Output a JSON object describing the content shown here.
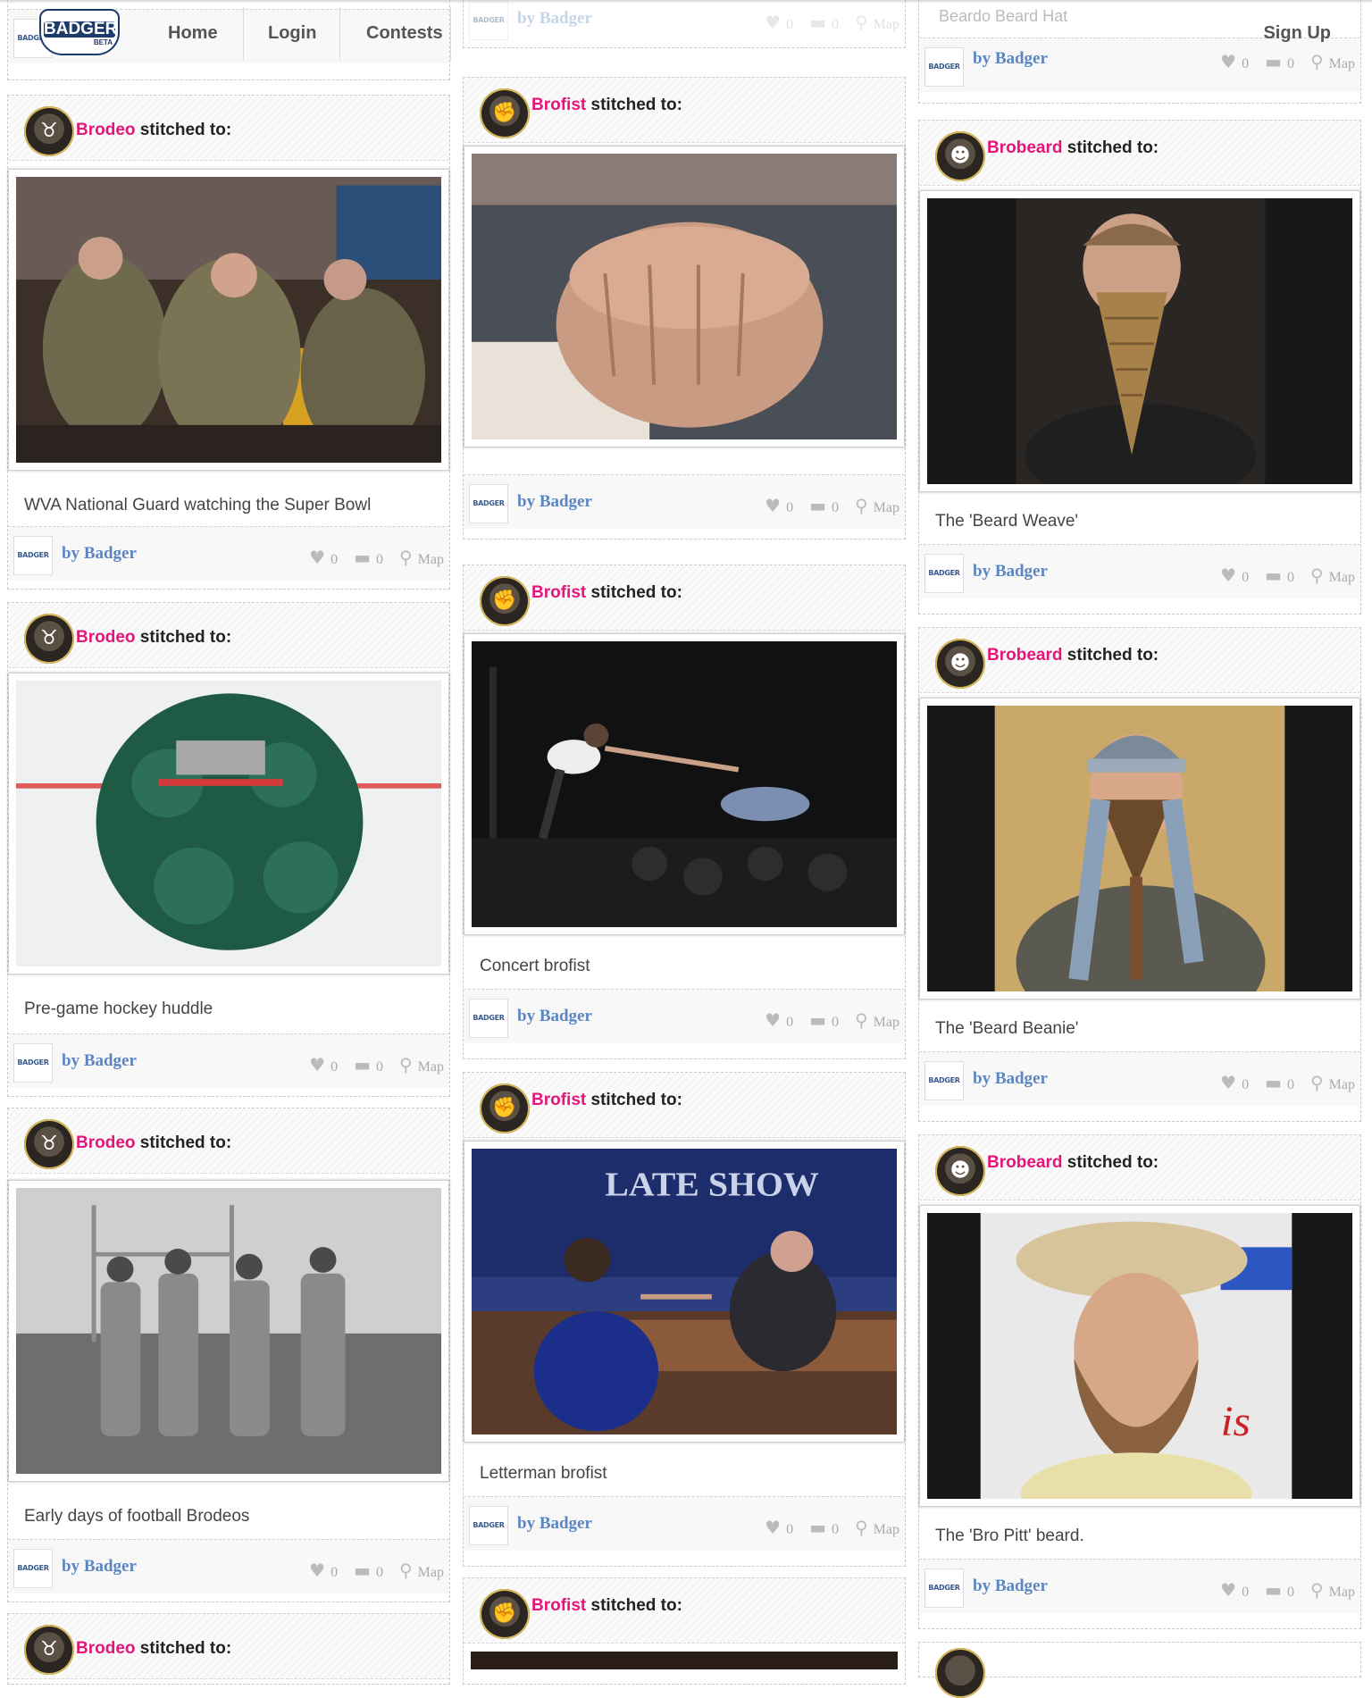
{
  "nav": {
    "logo": "BADGER",
    "logo_beta": "BETA",
    "home": "Home",
    "login": "Login",
    "contests": "Contests",
    "signup": "Sign Up"
  },
  "partial": {
    "col3_title": "Beardo Beard Hat",
    "mini_logo": "BADGER",
    "by": "by Badger",
    "likes": "0",
    "comments": "0",
    "map": "Map"
  },
  "columns": [
    {
      "cards": [
        {
          "user": "Brodeo",
          "stitched": "stitched to:",
          "caption": "WVA National Guard watching the Super Bowl",
          "by": "by Badger",
          "likes": "0",
          "comments": "0",
          "map": "Map"
        },
        {
          "user": "Brodeo",
          "stitched": "stitched to:",
          "caption": "Pre-game hockey huddle",
          "by": "by Badger",
          "likes": "0",
          "comments": "0",
          "map": "Map"
        },
        {
          "user": "Brodeo",
          "stitched": "stitched to:",
          "caption": "Early days of football Brodeos",
          "by": "by Badger",
          "likes": "0",
          "comments": "0",
          "map": "Map"
        },
        {
          "user": "Brodeo",
          "stitched": "stitched to:"
        }
      ]
    },
    {
      "cards": [
        {
          "user": "Brofist",
          "stitched": "stitched to:",
          "caption": "",
          "by": "by Badger",
          "likes": "0",
          "comments": "0",
          "map": "Map"
        },
        {
          "user": "Brofist",
          "stitched": "stitched to:",
          "caption": "Concert brofist",
          "by": "by Badger",
          "likes": "0",
          "comments": "0",
          "map": "Map"
        },
        {
          "user": "Brofist",
          "stitched": "stitched to:",
          "caption": "Letterman brofist",
          "by": "by Badger",
          "likes": "0",
          "comments": "0",
          "map": "Map"
        },
        {
          "user": "Brofist",
          "stitched": "stitched to:"
        }
      ]
    },
    {
      "cards": [
        {
          "user": "Brobeard",
          "stitched": "stitched to:",
          "caption": "The 'Beard Weave'",
          "by": "by Badger",
          "likes": "0",
          "comments": "0",
          "map": "Map"
        },
        {
          "user": "Brobeard",
          "stitched": "stitched to:",
          "caption": "The 'Beard Beanie'",
          "by": "by Badger",
          "likes": "0",
          "comments": "0",
          "map": "Map"
        },
        {
          "user": "Brobeard",
          "stitched": "stitched to:",
          "caption": "The 'Bro Pitt' beard.",
          "by": "by Badger",
          "likes": "0",
          "comments": "0",
          "map": "Map"
        }
      ]
    }
  ],
  "icons": {
    "like": "heart-icon",
    "comment": "comment-icon",
    "map": "map-pin-icon"
  },
  "colors": {
    "username": "#e5157a",
    "byline": "#5b86c2",
    "logo_blue": "#1c3b6b"
  }
}
